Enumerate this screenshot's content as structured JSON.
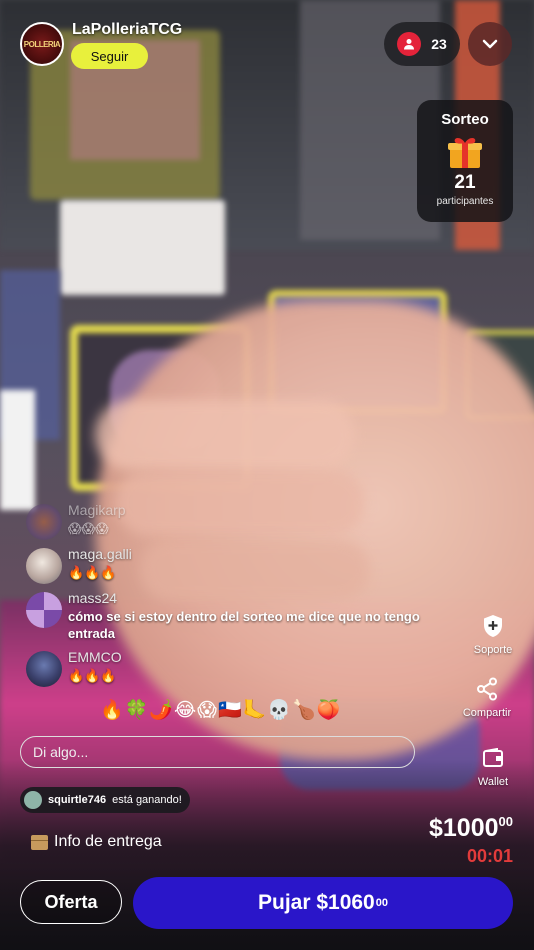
{
  "header": {
    "seller_name": "LaPolleriaTCG",
    "avatar_text": "POLLERIA",
    "follow_label": "Seguir",
    "viewer_count": "23"
  },
  "giveaway": {
    "title": "Sorteo",
    "count": "21",
    "subtitle": "participantes"
  },
  "chat": {
    "messages": [
      {
        "user": "Magikarp",
        "text": "😱😱😱"
      },
      {
        "user": "maga.galli",
        "text": "🔥🔥🔥"
      },
      {
        "user": "mass24",
        "text": "cómo se si estoy dentro del sorteo me dice que no tengo entrada"
      },
      {
        "user": "EMMCO",
        "text": "🔥🔥🔥"
      }
    ],
    "reactions": "🔥🍀🌶️😂😱🇨🇱🦶💀🍗🍑",
    "input_placeholder": "Di algo..."
  },
  "winner": {
    "user": "squirtle746",
    "text": "está ganando!"
  },
  "delivery_label": "Info de entrega",
  "side_actions": {
    "support": "Soporte",
    "share": "Compartir",
    "wallet": "Wallet"
  },
  "auction": {
    "price_main": "$1000",
    "price_cents": "00",
    "timer": "00:01",
    "offer_label": "Oferta",
    "bid_label": "Pujar $1060",
    "bid_cents": "00"
  },
  "colors": {
    "follow": "#e8f03c",
    "bid": "#2a16c9",
    "timer": "#e23b3b",
    "viewer_badge": "#e4233a"
  }
}
